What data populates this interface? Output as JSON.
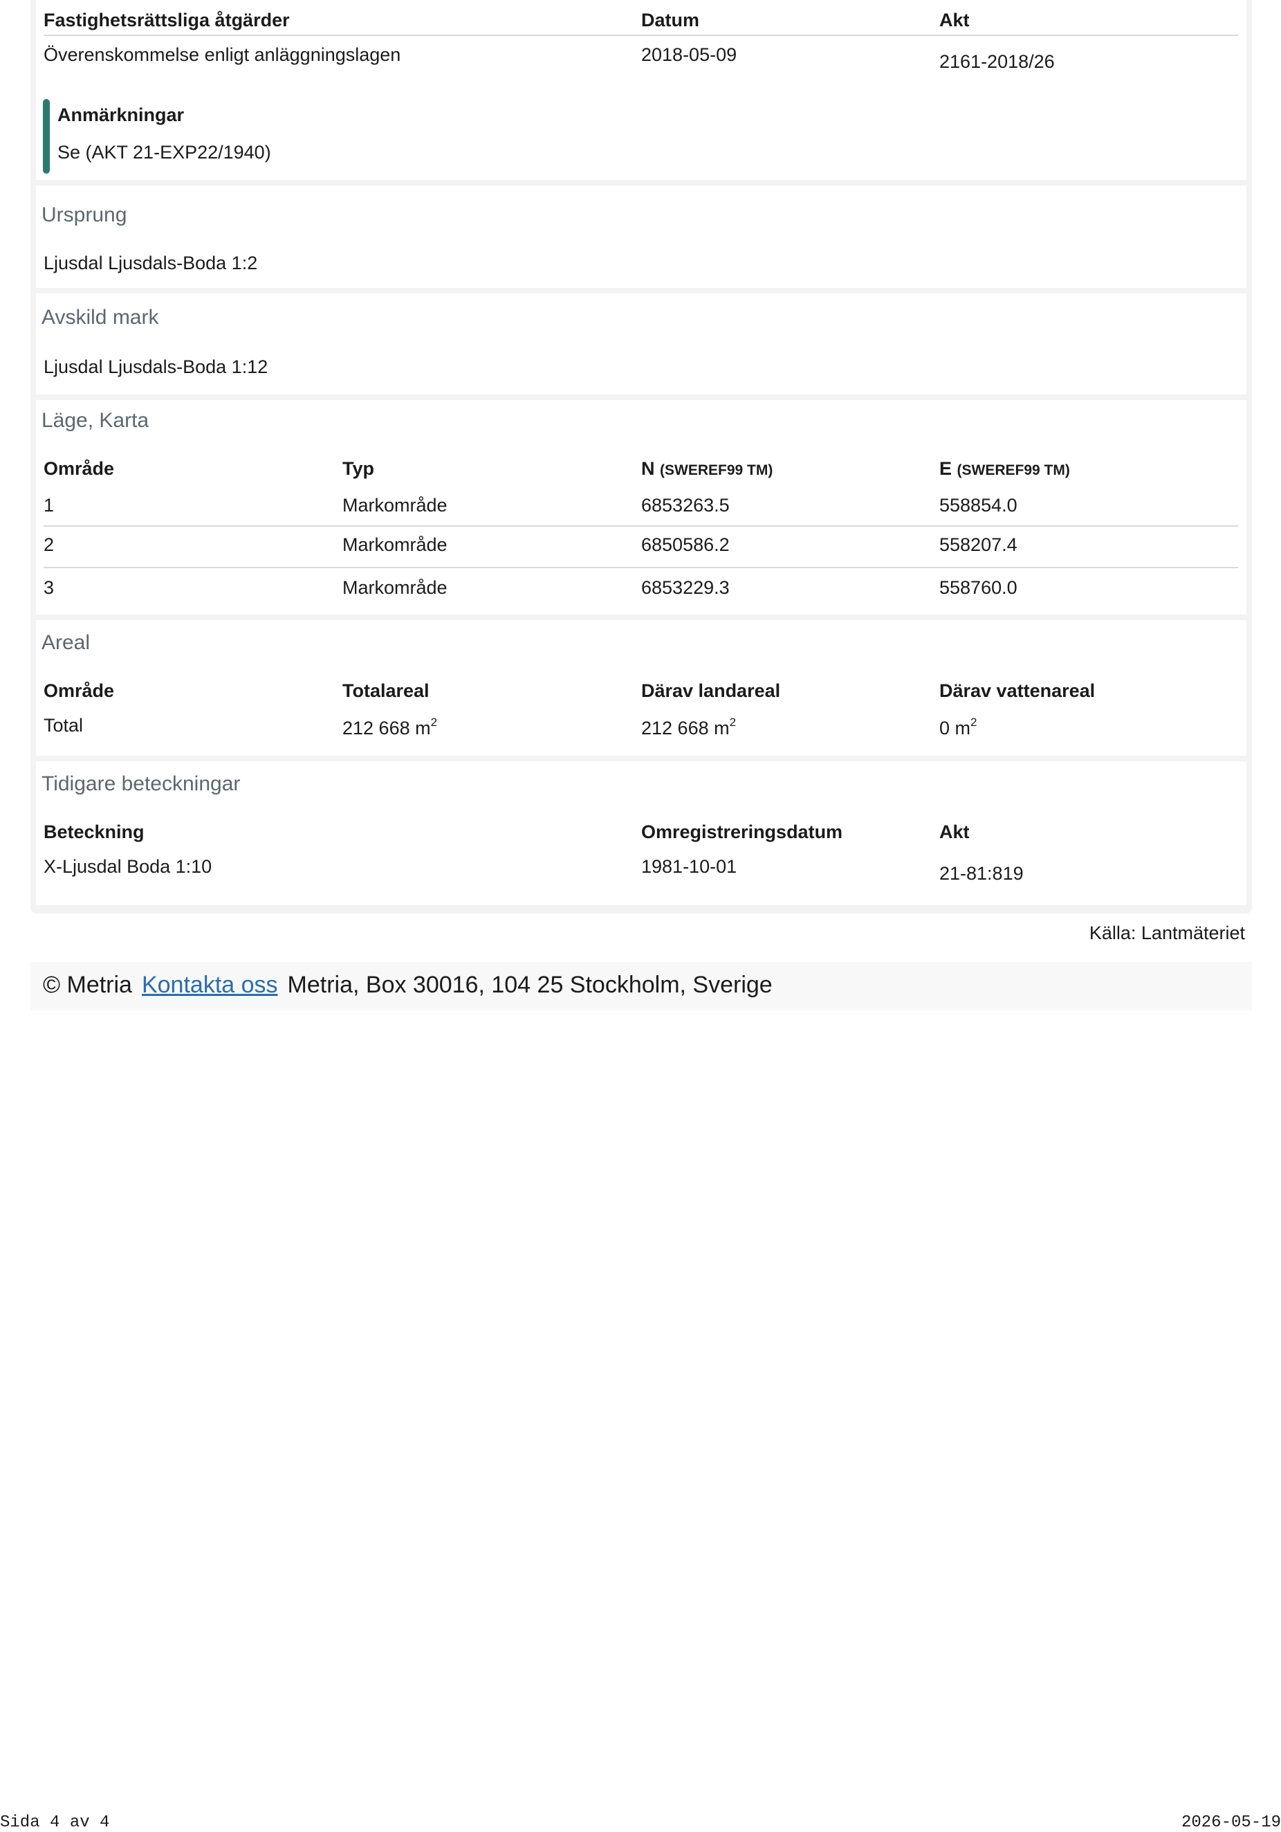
{
  "actions": {
    "headers": {
      "measure": "Fastighetsrättsliga åtgärder",
      "date": "Datum",
      "file": "Akt"
    },
    "rows": [
      {
        "measure": "Överenskommelse enligt anläggningslagen",
        "date": "2018-05-09",
        "file": "2161-2018/26"
      }
    ],
    "remarks_title": "Anmärkningar",
    "remarks_text": "Se (AKT 21-EXP22/1940)"
  },
  "origin": {
    "title": "Ursprung",
    "value": "Ljusdal Ljusdals-Boda 1:2"
  },
  "separated": {
    "title": "Avskild mark",
    "value": "Ljusdal Ljusdals-Boda 1:12"
  },
  "location": {
    "title": "Läge, Karta",
    "headers": {
      "area": "Område",
      "type": "Typ",
      "n": "N",
      "n_unit": "(SWEREF99 TM)",
      "e": "E",
      "e_unit": "(SWEREF99 TM)"
    },
    "rows": [
      {
        "area": "1",
        "type": "Markområde",
        "n": "6853263.5",
        "e": "558854.0"
      },
      {
        "area": "2",
        "type": "Markområde",
        "n": "6850586.2",
        "e": "558207.4"
      },
      {
        "area": "3",
        "type": "Markområde",
        "n": "6853229.3",
        "e": "558760.0"
      }
    ]
  },
  "areal": {
    "title": "Areal",
    "headers": {
      "area": "Område",
      "total": "Totalareal",
      "land": "Därav landareal",
      "water": "Därav vattenareal"
    },
    "unit": "m",
    "unit_exp": "2",
    "row": {
      "area": "Total",
      "total": "212 668",
      "land": "212 668",
      "water": "0"
    }
  },
  "former": {
    "title": "Tidigare beteckningar",
    "headers": {
      "designation": "Beteckning",
      "date": "Omregistreringsdatum",
      "file": "Akt"
    },
    "row": {
      "designation": "X-Ljusdal Boda 1:10",
      "date": "1981-10-01",
      "file": "21-81:819"
    }
  },
  "source": "Källa: Lantmäteriet",
  "footer": {
    "copyright": "© Metria",
    "contact_link": "Kontakta oss",
    "address": "Metria, Box 30016, 104 25 Stockholm, Sverige"
  },
  "page": {
    "label": "Sida 4 av 4",
    "date": "2026-05-19"
  }
}
